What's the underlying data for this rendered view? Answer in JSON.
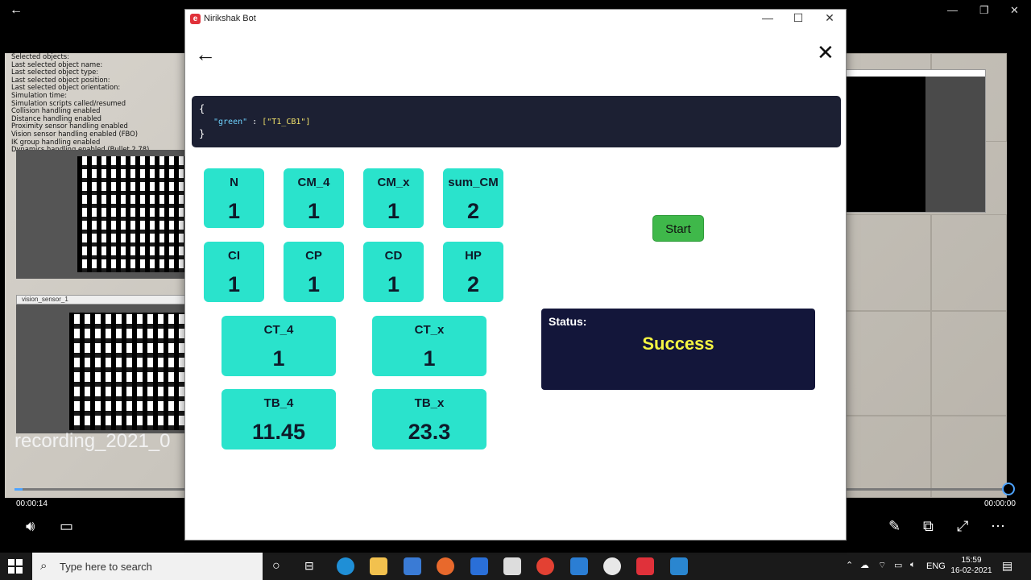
{
  "player": {
    "recording_title": "recording_2021_0",
    "time_elapsed": "00:00:14",
    "time_remaining": "00:00:00",
    "info_lines": [
      "Selected objects:",
      "Last selected object name:",
      "Last selected object type:",
      "Last selected object position:",
      "Last selected object orientation:",
      "Simulation time:",
      "Simulation scripts called/resumed",
      "Collision handling enabled",
      "Distance handling enabled",
      "Proximity sensor handling enabled",
      "Vision sensor handling enabled (FBO)",
      "IK group handling enabled",
      "Dynamics handling enabled (Bullet 2.78)"
    ],
    "vision_sensor_label": "vision_sensor_1"
  },
  "window": {
    "title": "Nirikshak Bot",
    "app_icon_letter": "e"
  },
  "json_display": {
    "open_brace": "{",
    "key": "\"green\"",
    "separator": " : ",
    "value": "[\"T1_CB1\"]",
    "close_brace": "}"
  },
  "metrics": [
    {
      "label": "N",
      "value": "1"
    },
    {
      "label": "CM_4",
      "value": "1"
    },
    {
      "label": "CM_x",
      "value": "1"
    },
    {
      "label": "sum_CM",
      "value": "2"
    },
    {
      "label": "CI",
      "value": "1"
    },
    {
      "label": "CP",
      "value": "1"
    },
    {
      "label": "CD",
      "value": "1"
    },
    {
      "label": "HP",
      "value": "2"
    },
    {
      "label": "CT_4",
      "value": "1"
    },
    {
      "label": "CT_x",
      "value": "1"
    },
    {
      "label": "TB_4",
      "value": "11.45"
    },
    {
      "label": "TB_x",
      "value": "23.3"
    }
  ],
  "start_button": "Start",
  "status": {
    "label": "Status:",
    "value": "Success"
  },
  "taskbar": {
    "search_placeholder": "Type here to search",
    "language": "ENG",
    "time": "15:59",
    "date": "16-02-2021"
  },
  "colors": {
    "card": "#2ae3cc",
    "json_bg": "#1c2033",
    "status_bg": "#13163a",
    "status_text": "#f5f542",
    "start_button": "#3fb84a"
  }
}
